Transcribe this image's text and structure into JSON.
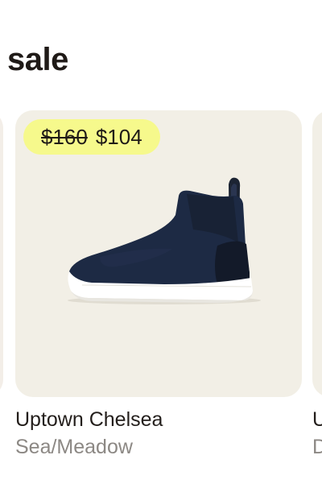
{
  "section": {
    "title": "sale"
  },
  "products": {
    "main": {
      "price_original": "$160",
      "price_sale": "$104",
      "name": "Uptown Chelsea",
      "color": "Sea/Meadow"
    },
    "next": {
      "name_partial": "U",
      "color_partial": "D"
    }
  },
  "colors": {
    "card_background": "#f2efe6",
    "badge_background": "#f6f98c",
    "text_primary": "#231e1b",
    "text_secondary": "#8c8884",
    "shoe_upper": "#1d2a44",
    "shoe_sole": "#ffffff"
  }
}
